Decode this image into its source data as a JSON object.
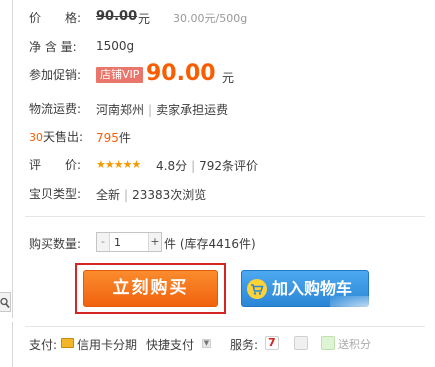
{
  "price": {
    "label": "价　　格:",
    "original": "90.00",
    "currency": "元",
    "unit_price": "30.00元/500g"
  },
  "net_weight": {
    "label": "净 含 量:",
    "value": "1500g"
  },
  "promotion": {
    "label": "参加促销:",
    "badge": "店铺VIP",
    "price": "90.00",
    "currency": "元"
  },
  "shipping": {
    "label": "物流运费:",
    "location": "河南郑州",
    "separator": "|",
    "fee": "卖家承担运费"
  },
  "sales": {
    "label_days": "30",
    "label_rest": "天售出:",
    "count": "795",
    "unit": "件"
  },
  "rating": {
    "label": "评　　价:",
    "stars": "★★★★★",
    "score": "4.8分",
    "separator": "|",
    "reviews": "792条评价"
  },
  "item_type": {
    "label": "宝贝类型:",
    "condition": "全新",
    "separator": "|",
    "views": "23383次浏览"
  },
  "quantity": {
    "label": "购买数量:",
    "minus": "-",
    "value": "1",
    "plus": "+",
    "stock": "件 (库存4416件)"
  },
  "buttons": {
    "buy_now": "立刻购买",
    "add_to_cart": "加入购物车"
  },
  "bottom_bar": {
    "pay_label": "支付:",
    "credit_card": "信用卡分期",
    "express_pay": "快捷支付",
    "service_label": "服务:",
    "svc_7_label": "7",
    "svc_3_text": "送积分"
  },
  "colors": {
    "promo_orange": "#f95d00",
    "buy_button": "#f0620e",
    "cart_button": "#2b86d6",
    "highlight_box": "#d42424"
  },
  "icons": {
    "zoom": "magnifier-icon",
    "cart": "shopping-cart-icon",
    "card": "credit-card-icon",
    "caret": "chevron-down-icon"
  }
}
